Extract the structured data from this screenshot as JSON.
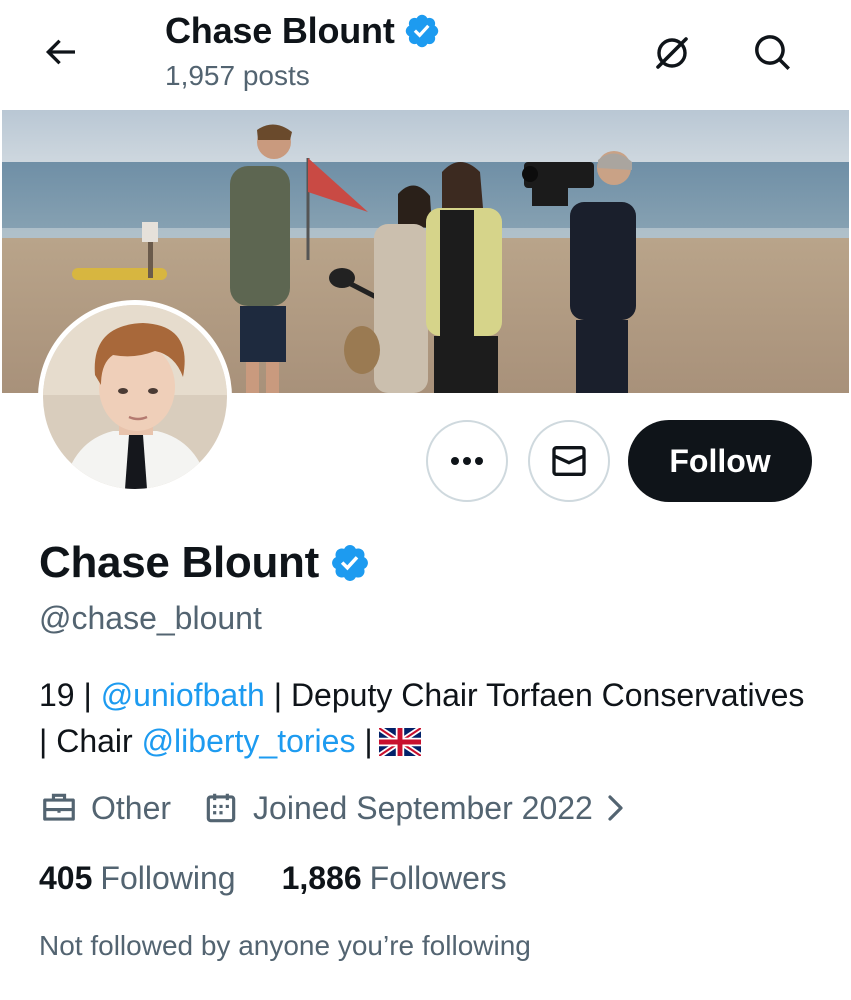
{
  "header": {
    "name": "Chase Blount",
    "posts": "1,957 posts",
    "back_icon": "arrow-left-icon",
    "grok_icon": "grok-icon",
    "search_icon": "search-icon"
  },
  "profile": {
    "name": "Chase Blount",
    "handle": "@chase_blount",
    "verified": true,
    "badge_color": "#1d9bf0",
    "bio": {
      "part1": "19 | ",
      "link1": "@uniofbath",
      "part2": " | Deputy Chair Torfaen Conservatives | Chair ",
      "link2": "@liberty_tories",
      "part3": " |",
      "flag": "uk-flag"
    },
    "category": "Other",
    "joined": "Joined September 2022",
    "following_count": "405",
    "following_label": "Following",
    "followers_count": "1,886",
    "followers_label": "Followers",
    "followed_by": "Not followed by anyone you’re following"
  },
  "actions": {
    "more_icon": "more-icon",
    "message_icon": "envelope-icon",
    "follow_label": "Follow"
  },
  "colors": {
    "link": "#1d9bf0",
    "secondary_text": "#536471",
    "primary_text": "#0f1419",
    "button_dark": "#0f1419"
  }
}
